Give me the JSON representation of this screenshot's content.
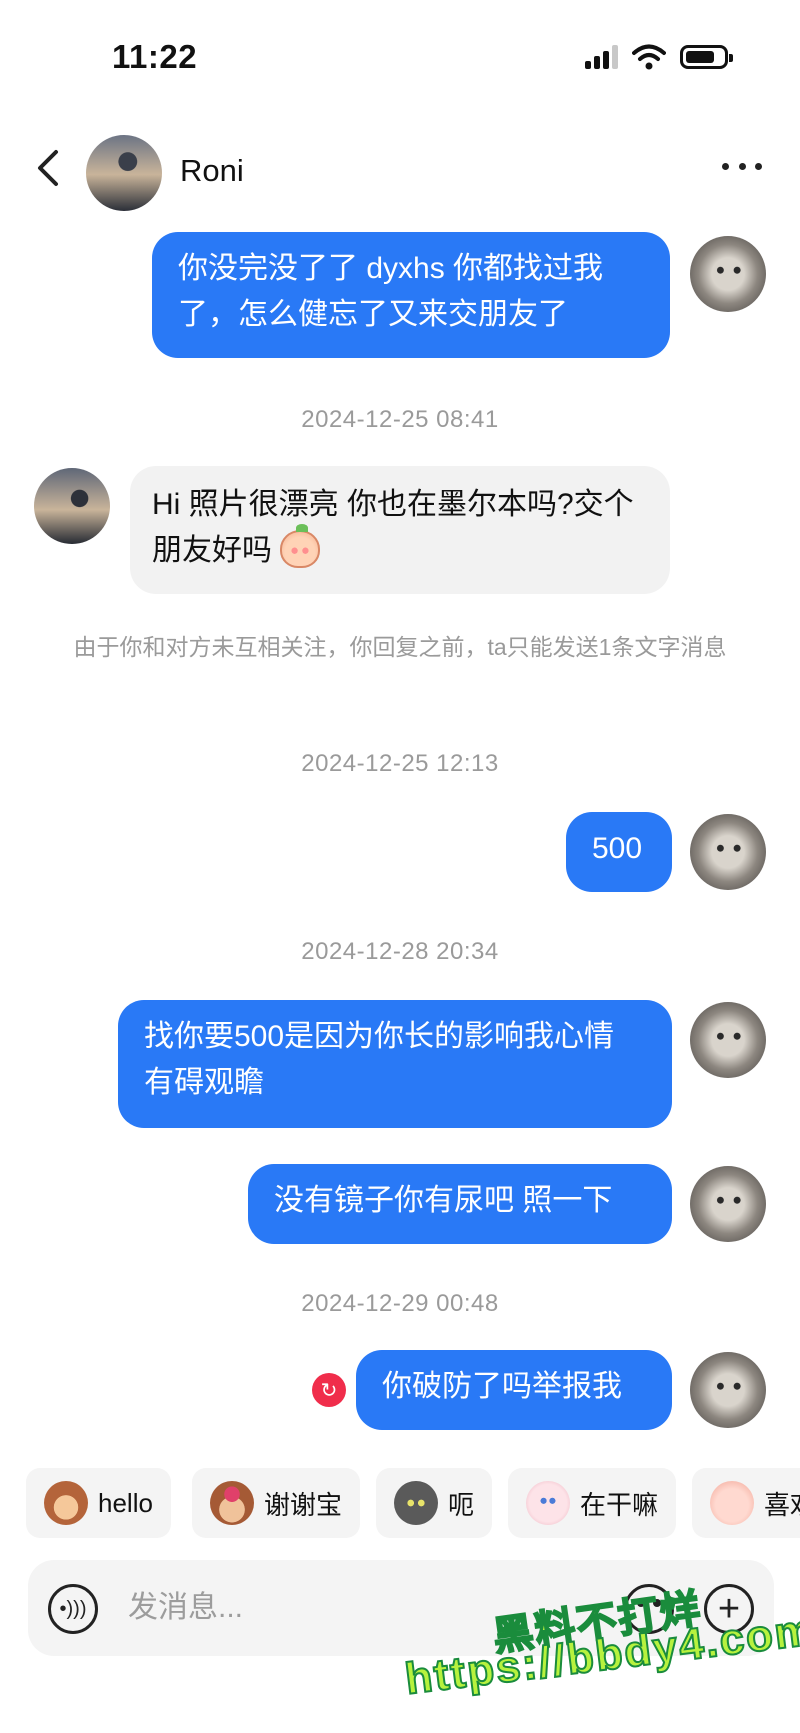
{
  "status_bar": {
    "time": "11:22"
  },
  "header": {
    "contact_name": "Roni"
  },
  "messages": [
    {
      "type": "outgoing",
      "text": "你没完没了了 dyxhs 你都找过我了，怎么健忘了又来交朋友了"
    },
    {
      "type": "timestamp",
      "text": "2024-12-25 08:41"
    },
    {
      "type": "incoming",
      "text": "Hi 照片很漂亮 你也在墨尔本吗?交个朋友好吗",
      "emoji": "peach-face-emoji"
    },
    {
      "type": "system",
      "text": "由于你和对方未互相关注，你回复之前，ta只能发送1条文字消息"
    },
    {
      "type": "timestamp",
      "text": "2024-12-25 12:13"
    },
    {
      "type": "outgoing",
      "text": "500"
    },
    {
      "type": "timestamp",
      "text": "2024-12-28 20:34"
    },
    {
      "type": "outgoing",
      "text": "找你要500是因为你长的影响我心情 有碍观瞻"
    },
    {
      "type": "outgoing",
      "text": "没有镜子你有尿吧 照一下"
    },
    {
      "type": "timestamp",
      "text": "2024-12-29 00:48"
    },
    {
      "type": "outgoing",
      "text": "你破防了吗举报我",
      "status_icon": "resend-icon"
    }
  ],
  "quick_replies": [
    {
      "label": "hello",
      "icon": "monkey-sticker-icon"
    },
    {
      "label": "谢谢宝",
      "icon": "flower-monkey-sticker-icon"
    },
    {
      "label": "呃",
      "icon": "cat-sticker-icon"
    },
    {
      "label": "在干嘛",
      "icon": "ghost-sticker-icon"
    },
    {
      "label": "喜欢",
      "icon": "pink-sticker-icon"
    }
  ],
  "input": {
    "placeholder": "发消息..."
  },
  "watermark": {
    "line1": "黑料不打烊",
    "line2": "https://bbdy4.com"
  },
  "colors": {
    "outgoing_bubble": "#2979f6",
    "incoming_bubble": "#f2f2f2",
    "resend": "#f02d4b",
    "watermark": "#b7f23e"
  }
}
